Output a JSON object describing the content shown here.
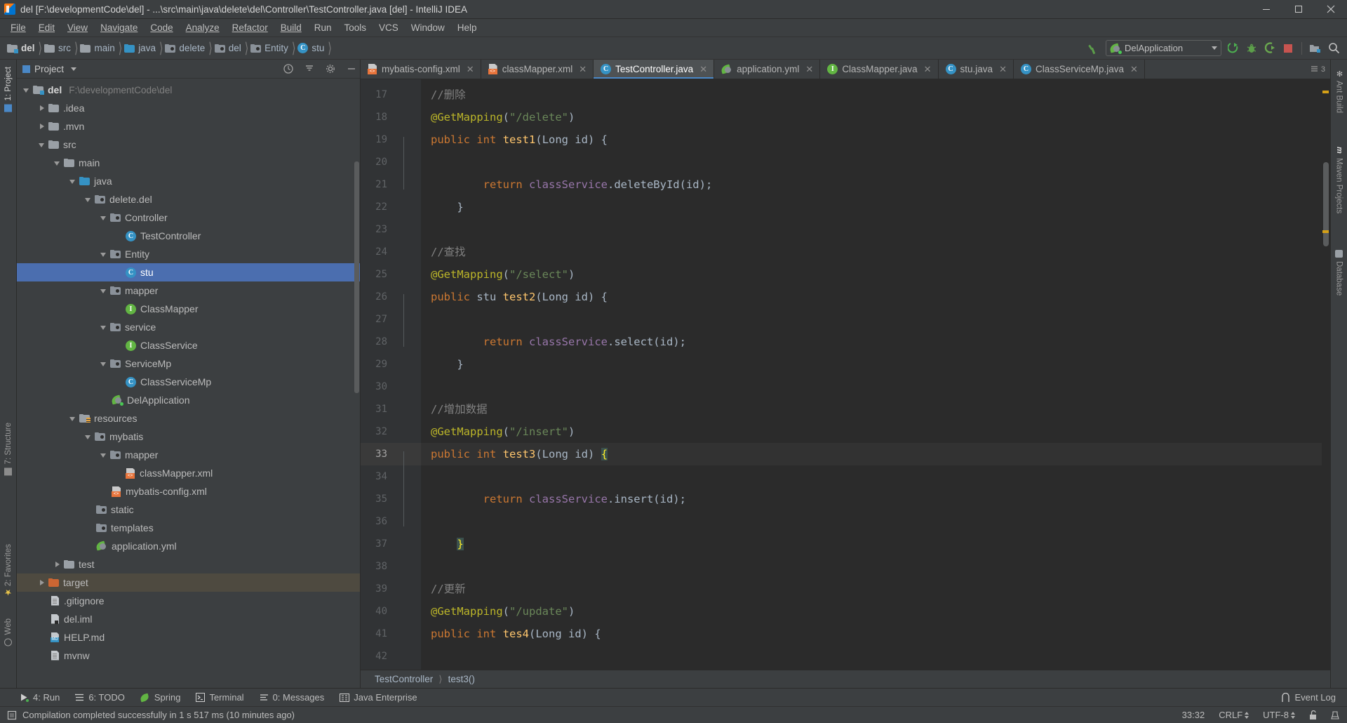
{
  "window": {
    "title": "del [F:\\developmentCode\\del] - ...\\src\\main\\java\\delete\\del\\Controller\\TestController.java [del] - IntelliJ IDEA",
    "app_icon": "intellij-idea-icon",
    "minimize": "minimize-icon",
    "maximize": "maximize-icon",
    "close": "close-icon"
  },
  "menu": [
    {
      "label": "File"
    },
    {
      "label": "Edit"
    },
    {
      "label": "View"
    },
    {
      "label": "Navigate"
    },
    {
      "label": "Code"
    },
    {
      "label": "Analyze"
    },
    {
      "label": "Refactor"
    },
    {
      "label": "Build"
    },
    {
      "label": "Run"
    },
    {
      "label": "Tools"
    },
    {
      "label": "VCS"
    },
    {
      "label": "Window"
    },
    {
      "label": "Help"
    }
  ],
  "navbar": {
    "breadcrumbs": [
      {
        "label": "del",
        "icon": "project-folder-icon"
      },
      {
        "label": "src",
        "icon": "folder-icon"
      },
      {
        "label": "main",
        "icon": "folder-icon"
      },
      {
        "label": "java",
        "icon": "source-folder-icon"
      },
      {
        "label": "delete",
        "icon": "package-icon"
      },
      {
        "label": "del",
        "icon": "package-icon"
      },
      {
        "label": "Entity",
        "icon": "package-icon"
      },
      {
        "label": "stu",
        "icon": "class-icon"
      }
    ],
    "run_config": "DelApplication",
    "run_config_icon": "spring-boot-icon",
    "buttons": [
      {
        "name": "build-hammer-icon"
      },
      {
        "name": "run-icon"
      },
      {
        "name": "debug-icon"
      },
      {
        "name": "run-with-coverage-icon"
      },
      {
        "name": "stop-icon"
      },
      {
        "name": "project-structure-icon"
      },
      {
        "name": "search-everywhere-icon"
      }
    ]
  },
  "project_panel": {
    "title": "Project",
    "header_buttons": [
      "scope-icon",
      "collapse-all-icon",
      "settings-gear-icon",
      "hide-icon"
    ],
    "tree": [
      {
        "depth": 0,
        "label": "del",
        "path": "F:\\developmentCode\\del",
        "icon": "project-folder-icon",
        "toggle": "down",
        "bold": true
      },
      {
        "depth": 1,
        "label": ".idea",
        "icon": "folder-icon",
        "toggle": "right"
      },
      {
        "depth": 1,
        "label": ".mvn",
        "icon": "folder-icon",
        "toggle": "right"
      },
      {
        "depth": 1,
        "label": "src",
        "icon": "folder-icon",
        "toggle": "down"
      },
      {
        "depth": 2,
        "label": "main",
        "icon": "folder-icon",
        "toggle": "down"
      },
      {
        "depth": 3,
        "label": "java",
        "icon": "source-folder-icon",
        "toggle": "down"
      },
      {
        "depth": 4,
        "label": "delete.del",
        "icon": "package-icon",
        "toggle": "down"
      },
      {
        "depth": 5,
        "label": "Controller",
        "icon": "package-icon",
        "toggle": "down"
      },
      {
        "depth": 6,
        "label": "TestController",
        "icon": "class-icon",
        "toggle": "none"
      },
      {
        "depth": 5,
        "label": "Entity",
        "icon": "package-icon",
        "toggle": "down"
      },
      {
        "depth": 6,
        "label": "stu",
        "icon": "class-icon",
        "toggle": "none",
        "selected": true
      },
      {
        "depth": 5,
        "label": "mapper",
        "icon": "package-icon",
        "toggle": "down"
      },
      {
        "depth": 6,
        "label": "ClassMapper",
        "icon": "interface-icon",
        "toggle": "none"
      },
      {
        "depth": 5,
        "label": "service",
        "icon": "package-icon",
        "toggle": "down"
      },
      {
        "depth": 6,
        "label": "ClassService",
        "icon": "interface-icon",
        "toggle": "none"
      },
      {
        "depth": 5,
        "label": "ServiceMp",
        "icon": "package-icon",
        "toggle": "down"
      },
      {
        "depth": 6,
        "label": "ClassServiceMp",
        "icon": "class-icon",
        "toggle": "none"
      },
      {
        "depth": 5,
        "label": "DelApplication",
        "icon": "spring-boot-icon",
        "toggle": "none"
      },
      {
        "depth": 3,
        "label": "resources",
        "icon": "resources-folder-icon",
        "toggle": "down"
      },
      {
        "depth": 4,
        "label": "mybatis",
        "icon": "package-icon",
        "toggle": "down"
      },
      {
        "depth": 5,
        "label": "mapper",
        "icon": "package-icon",
        "toggle": "down"
      },
      {
        "depth": 6,
        "label": "classMapper.xml",
        "icon": "xml-file-icon",
        "toggle": "none"
      },
      {
        "depth": 5,
        "label": "mybatis-config.xml",
        "icon": "xml-file-icon",
        "toggle": "none"
      },
      {
        "depth": 4,
        "label": "static",
        "icon": "package-icon",
        "toggle": "none"
      },
      {
        "depth": 4,
        "label": "templates",
        "icon": "package-icon",
        "toggle": "none"
      },
      {
        "depth": 4,
        "label": "application.yml",
        "icon": "spring-yaml-icon",
        "toggle": "none"
      },
      {
        "depth": 2,
        "label": "test",
        "icon": "folder-icon",
        "toggle": "right"
      },
      {
        "depth": 1,
        "label": "target",
        "icon": "excluded-folder-icon",
        "toggle": "right",
        "highlight": true
      },
      {
        "depth": 1,
        "label": ".gitignore",
        "icon": "file-icon",
        "toggle": "none"
      },
      {
        "depth": 1,
        "label": "del.iml",
        "icon": "iml-file-icon",
        "toggle": "none"
      },
      {
        "depth": 1,
        "label": "HELP.md",
        "icon": "markdown-file-icon",
        "toggle": "none"
      },
      {
        "depth": 1,
        "label": "mvnw",
        "icon": "file-icon",
        "toggle": "none"
      }
    ]
  },
  "editor_tabs": [
    {
      "label": "mybatis-config.xml",
      "icon": "xml-file-icon",
      "active": false
    },
    {
      "label": "classMapper.xml",
      "icon": "xml-file-icon",
      "active": false
    },
    {
      "label": "TestController.java",
      "icon": "class-icon",
      "active": true
    },
    {
      "label": "application.yml",
      "icon": "spring-yaml-icon",
      "active": false
    },
    {
      "label": "ClassMapper.java",
      "icon": "interface-icon",
      "active": false
    },
    {
      "label": "stu.java",
      "icon": "class-icon",
      "active": false
    },
    {
      "label": "ClassServiceMp.java",
      "icon": "class-icon",
      "active": false
    }
  ],
  "tabs_overflow_count": "3",
  "code": {
    "first_line": 17,
    "current_line": 33,
    "lines": [
      {
        "n": 17,
        "tokens": [
          {
            "t": "    ",
            "c": "pl"
          },
          {
            "t": "//删除",
            "c": "cm"
          }
        ]
      },
      {
        "n": 18,
        "tokens": [
          {
            "t": "    ",
            "c": "pl"
          },
          {
            "t": "@GetMapping",
            "c": "an"
          },
          {
            "t": "(",
            "c": "pl"
          },
          {
            "t": "\"/delete\"",
            "c": "st"
          },
          {
            "t": ")",
            "c": "pl"
          }
        ]
      },
      {
        "n": 19,
        "fold": "start",
        "tokens": [
          {
            "t": "    ",
            "c": "pl"
          },
          {
            "t": "public",
            "c": "k"
          },
          {
            "t": " ",
            "c": "pl"
          },
          {
            "t": "int",
            "c": "k"
          },
          {
            "t": " ",
            "c": "pl"
          },
          {
            "t": "test1",
            "c": "fn"
          },
          {
            "t": "(Long id) {",
            "c": "pl"
          }
        ]
      },
      {
        "n": 20,
        "tokens": [
          {
            "t": "",
            "c": "pl"
          }
        ]
      },
      {
        "n": 21,
        "tokens": [
          {
            "t": "        ",
            "c": "pl"
          },
          {
            "t": "return",
            "c": "k"
          },
          {
            "t": " ",
            "c": "pl"
          },
          {
            "t": "classService",
            "c": "fd"
          },
          {
            "t": ".deleteById(id)",
            "c": "pl"
          },
          {
            "t": ";",
            "c": "pl"
          }
        ]
      },
      {
        "n": 22,
        "fold": "end",
        "tokens": [
          {
            "t": "    }",
            "c": "pl"
          }
        ]
      },
      {
        "n": 23,
        "tokens": [
          {
            "t": "",
            "c": "pl"
          }
        ]
      },
      {
        "n": 24,
        "tokens": [
          {
            "t": "    ",
            "c": "pl"
          },
          {
            "t": "//查找",
            "c": "cm"
          }
        ]
      },
      {
        "n": 25,
        "tokens": [
          {
            "t": "    ",
            "c": "pl"
          },
          {
            "t": "@GetMapping",
            "c": "an"
          },
          {
            "t": "(",
            "c": "pl"
          },
          {
            "t": "\"/select\"",
            "c": "st"
          },
          {
            "t": ")",
            "c": "pl"
          }
        ]
      },
      {
        "n": 26,
        "fold": "start",
        "tokens": [
          {
            "t": "    ",
            "c": "pl"
          },
          {
            "t": "public",
            "c": "k"
          },
          {
            "t": " stu ",
            "c": "pl"
          },
          {
            "t": "test2",
            "c": "fn"
          },
          {
            "t": "(Long id) {",
            "c": "pl"
          }
        ]
      },
      {
        "n": 27,
        "tokens": [
          {
            "t": "",
            "c": "pl"
          }
        ]
      },
      {
        "n": 28,
        "tokens": [
          {
            "t": "        ",
            "c": "pl"
          },
          {
            "t": "return",
            "c": "k"
          },
          {
            "t": " ",
            "c": "pl"
          },
          {
            "t": "classService",
            "c": "fd"
          },
          {
            "t": ".select(id)",
            "c": "pl"
          },
          {
            "t": ";",
            "c": "pl"
          }
        ]
      },
      {
        "n": 29,
        "fold": "end",
        "tokens": [
          {
            "t": "    }",
            "c": "pl"
          }
        ]
      },
      {
        "n": 30,
        "tokens": [
          {
            "t": "",
            "c": "pl"
          }
        ]
      },
      {
        "n": 31,
        "tokens": [
          {
            "t": "    ",
            "c": "pl"
          },
          {
            "t": "//增加数据",
            "c": "cm"
          }
        ]
      },
      {
        "n": 32,
        "tokens": [
          {
            "t": "    ",
            "c": "pl"
          },
          {
            "t": "@GetMapping",
            "c": "an"
          },
          {
            "t": "(",
            "c": "pl"
          },
          {
            "t": "\"/insert\"",
            "c": "st"
          },
          {
            "t": ")",
            "c": "pl"
          }
        ]
      },
      {
        "n": 33,
        "fold": "start",
        "current": true,
        "tokens": [
          {
            "t": "    ",
            "c": "pl"
          },
          {
            "t": "public",
            "c": "k"
          },
          {
            "t": " ",
            "c": "pl"
          },
          {
            "t": "int",
            "c": "k"
          },
          {
            "t": " ",
            "c": "pl"
          },
          {
            "t": "test3",
            "c": "fn"
          },
          {
            "t": "(Long id) ",
            "c": "pl"
          },
          {
            "t": "{",
            "c": "br-hl"
          }
        ]
      },
      {
        "n": 34,
        "tokens": [
          {
            "t": "",
            "c": "pl"
          }
        ]
      },
      {
        "n": 35,
        "tokens": [
          {
            "t": "        ",
            "c": "pl"
          },
          {
            "t": "return",
            "c": "k"
          },
          {
            "t": " ",
            "c": "pl"
          },
          {
            "t": "classService",
            "c": "fd"
          },
          {
            "t": ".insert(id)",
            "c": "pl"
          },
          {
            "t": ";",
            "c": "pl"
          }
        ]
      },
      {
        "n": 36,
        "tokens": [
          {
            "t": "",
            "c": "pl"
          }
        ]
      },
      {
        "n": 37,
        "fold": "end",
        "tokens": [
          {
            "t": "    ",
            "c": "pl"
          },
          {
            "t": "}",
            "c": "br-hl"
          }
        ]
      },
      {
        "n": 38,
        "tokens": [
          {
            "t": "",
            "c": "pl"
          }
        ]
      },
      {
        "n": 39,
        "tokens": [
          {
            "t": "    ",
            "c": "pl"
          },
          {
            "t": "//更新",
            "c": "cm"
          }
        ]
      },
      {
        "n": 40,
        "tokens": [
          {
            "t": "    ",
            "c": "pl"
          },
          {
            "t": "@GetMapping",
            "c": "an"
          },
          {
            "t": "(",
            "c": "pl"
          },
          {
            "t": "\"/update\"",
            "c": "st"
          },
          {
            "t": ")",
            "c": "pl"
          }
        ]
      },
      {
        "n": 41,
        "fold": "start",
        "tokens": [
          {
            "t": "    ",
            "c": "pl"
          },
          {
            "t": "public",
            "c": "k"
          },
          {
            "t": " ",
            "c": "pl"
          },
          {
            "t": "int",
            "c": "k"
          },
          {
            "t": " ",
            "c": "pl"
          },
          {
            "t": "tes4",
            "c": "fn"
          },
          {
            "t": "(Long id) {",
            "c": "pl"
          }
        ]
      },
      {
        "n": 42,
        "tokens": [
          {
            "t": "",
            "c": "pl"
          }
        ]
      }
    ]
  },
  "editor_breadcrumb": [
    "TestController",
    "test3()"
  ],
  "left_strip": [
    {
      "label": "1: Project",
      "icon": "project-icon",
      "active": true
    },
    {
      "label": "7: Structure",
      "icon": "structure-icon"
    },
    {
      "label": "2: Favorites",
      "icon": "favorites-icon"
    },
    {
      "label": "Web",
      "icon": "web-icon"
    }
  ],
  "right_strip": [
    {
      "label": "Ant Build",
      "icon": "ant-icon"
    },
    {
      "label": "Maven Projects",
      "icon": "maven-icon"
    },
    {
      "label": "Database",
      "icon": "database-icon"
    }
  ],
  "tool_windows": [
    {
      "label": "4: Run",
      "icon": "run-icon"
    },
    {
      "label": "6: TODO",
      "icon": "todo-icon"
    },
    {
      "label": "Spring",
      "icon": "spring-icon"
    },
    {
      "label": "Terminal",
      "icon": "terminal-icon"
    },
    {
      "label": "0: Messages",
      "icon": "messages-icon"
    },
    {
      "label": "Java Enterprise",
      "icon": "java-enterprise-icon"
    }
  ],
  "event_log": {
    "label": "Event Log",
    "icon": "event-log-icon"
  },
  "status": {
    "message": "Compilation completed successfully in 1 s 517 ms (10 minutes ago)",
    "message_icon": "build-status-icon",
    "caret": "33:32",
    "line_separator": "CRLF",
    "encoding": "UTF-8",
    "lock_icon": "unlocked-icon",
    "inspector_icon": "inspection-icon"
  },
  "colors": {
    "chrome": "#3c3f41",
    "editor_bg": "#2b2b2b",
    "accent": "#4b6eaf",
    "tab_active_underline": "#4a88c7",
    "keyword": "#cc7832",
    "string": "#6a8759",
    "annotation": "#bbb529",
    "comment": "#808080",
    "method": "#ffc66d",
    "field": "#9876aa",
    "plain": "#a9b7c6"
  }
}
